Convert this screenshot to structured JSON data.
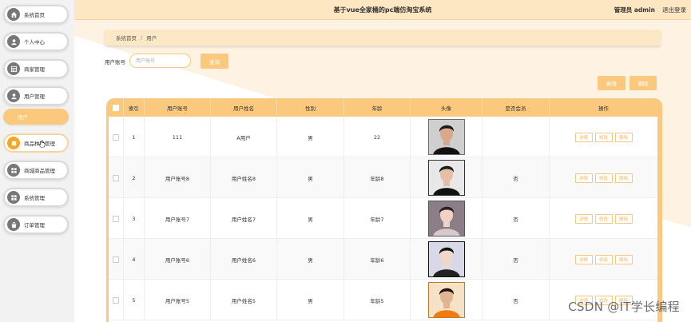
{
  "header": {
    "title": "基于vue全家桶的pc端仿淘宝系统",
    "user": "管理员 admin",
    "logout": "退出登录"
  },
  "sidebar": {
    "items": [
      {
        "label": "系统首页",
        "icon": "home-icon"
      },
      {
        "label": "个人中心",
        "icon": "user-icon"
      },
      {
        "label": "商家管理",
        "icon": "grid-icon"
      },
      {
        "label": "用户管理",
        "icon": "user-icon"
      },
      {
        "label": "用户",
        "icon": ""
      },
      {
        "label": "商品种类管理",
        "icon": "category-icon"
      },
      {
        "label": "商城商品管理",
        "icon": "apps-icon"
      },
      {
        "label": "系统管理",
        "icon": "apps-icon"
      },
      {
        "label": "订单管理",
        "icon": "bag-icon"
      }
    ]
  },
  "breadcrumb": {
    "home": "系统首页",
    "separator": "/",
    "current": "用户"
  },
  "search": {
    "label": "用户账号",
    "placeholder": "用户账号",
    "query_button": "查询"
  },
  "toolbar": {
    "add": "新增",
    "delete": "删除"
  },
  "table": {
    "columns": [
      "索引",
      "用户账号",
      "用户姓名",
      "性别",
      "年龄",
      "头像",
      "是否会员",
      "操作"
    ],
    "rows": [
      {
        "index": "1",
        "account": "111",
        "name": "A用户",
        "gender": "男",
        "age": "22",
        "member": ""
      },
      {
        "index": "2",
        "account": "用户账号8",
        "name": "用户姓名8",
        "gender": "男",
        "age": "年龄8",
        "member": "否"
      },
      {
        "index": "3",
        "account": "用户账号7",
        "name": "用户姓名7",
        "gender": "男",
        "age": "年龄7",
        "member": "否"
      },
      {
        "index": "4",
        "account": "用户账号6",
        "name": "用户姓名6",
        "gender": "男",
        "age": "年龄6",
        "member": "否"
      },
      {
        "index": "5",
        "account": "用户账号5",
        "name": "用户姓名5",
        "gender": "男",
        "age": "年龄5",
        "member": "否"
      }
    ],
    "actions": {
      "detail": "详情",
      "edit": "修改",
      "delete": "删除"
    }
  },
  "watermark": "CSDN @IT学长编程",
  "colors": {
    "accent": "#fbc97d",
    "header_bg": "#fde6c2",
    "sidebar_bg": "#f2f2f2"
  }
}
